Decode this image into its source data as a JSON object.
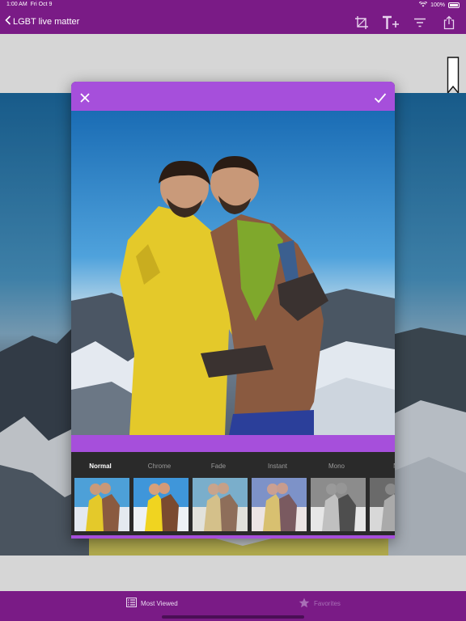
{
  "status": {
    "time": "1:00 AM",
    "date": "Fri Oct 9",
    "battery": "100%"
  },
  "nav": {
    "back_label": "LGBT live matter"
  },
  "filters": [
    {
      "label": "Normal",
      "selected": true
    },
    {
      "label": "Chrome",
      "selected": false
    },
    {
      "label": "Fade",
      "selected": false
    },
    {
      "label": "Instant",
      "selected": false
    },
    {
      "label": "Mono",
      "selected": false
    },
    {
      "label": "N",
      "selected": false
    }
  ],
  "tabs": {
    "most_viewed": "Most Viewed",
    "favorites": "Favorites"
  },
  "colors": {
    "nav_bar": "#7a1b86",
    "modal_accent": "#a64fdb",
    "filter_strip": "#2a2a2a"
  },
  "icons": {
    "back": "chevron-left-icon",
    "crop": "crop-icon",
    "text": "text-add-icon",
    "filter": "filter-icon",
    "share": "share-icon",
    "close": "close-icon",
    "confirm": "checkmark-icon",
    "list": "list-icon",
    "star": "star-icon",
    "bookmark": "bookmark-icon"
  }
}
